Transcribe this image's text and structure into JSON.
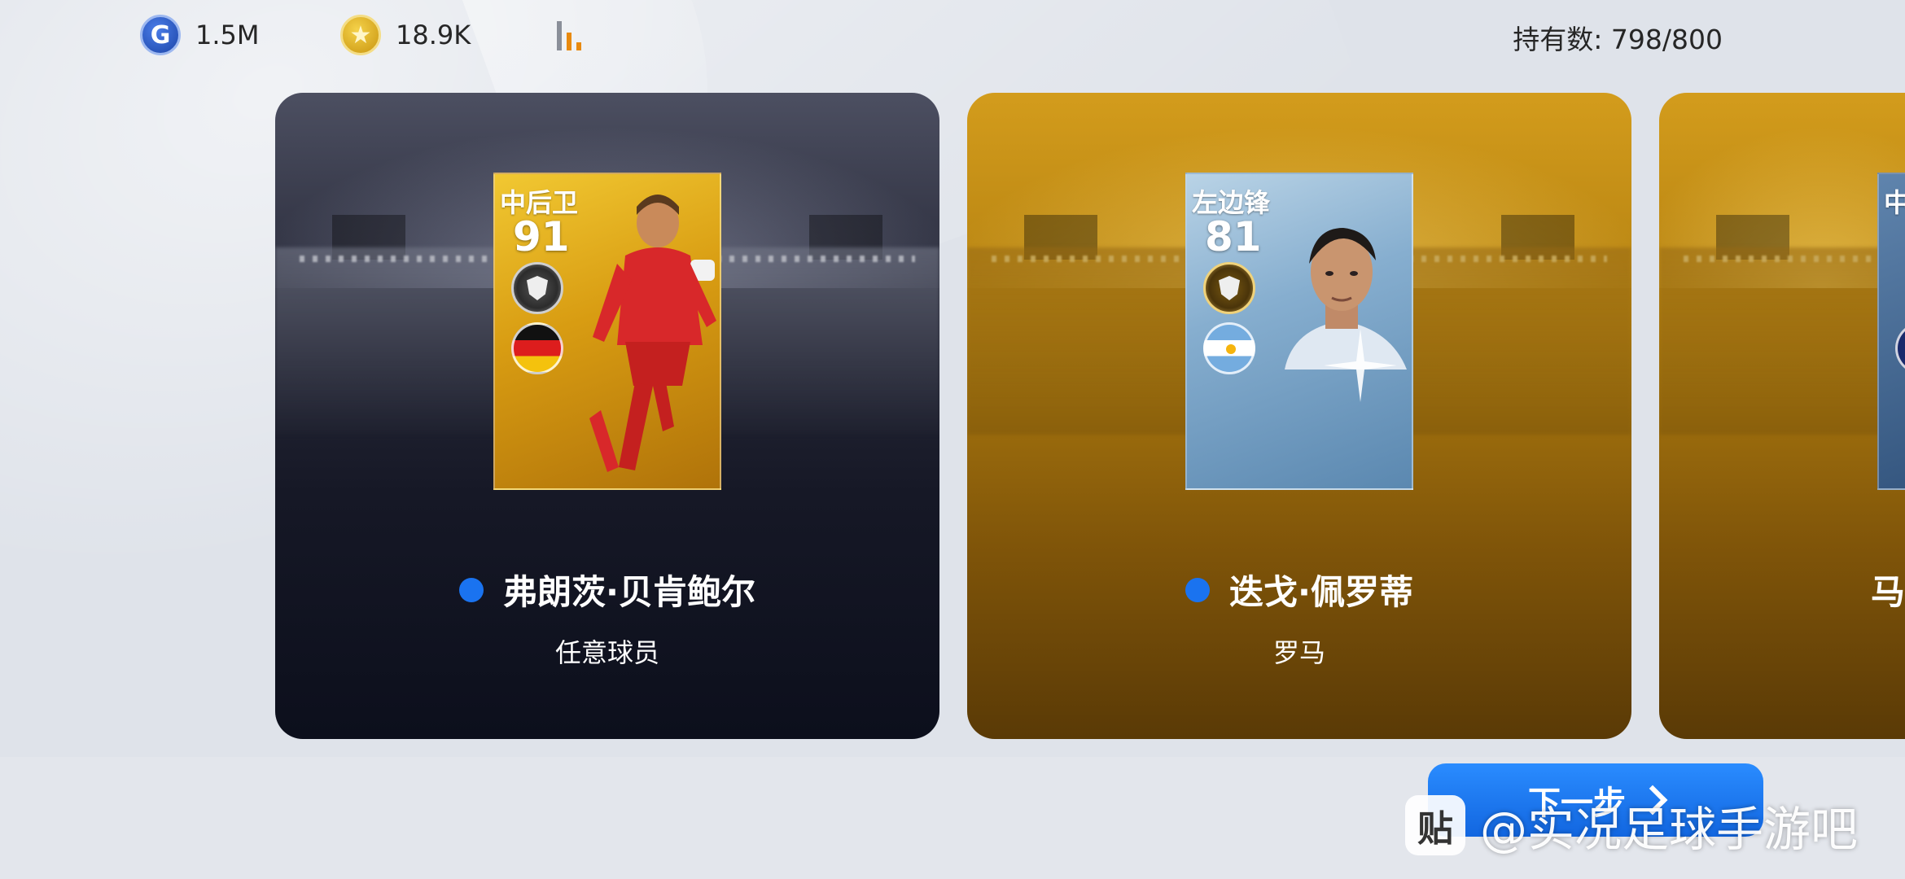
{
  "top_bar": {
    "gp": {
      "icon": "gp-coin-icon",
      "letter": "G",
      "value": "1.5M"
    },
    "coins": {
      "icon": "star-coin-icon",
      "letter": "★",
      "value": "18.9K"
    },
    "holding": "持有数: 798/800"
  },
  "cards": [
    {
      "position": "中后卫",
      "rating": "91",
      "name": "弗朗茨·贝肯鲍尔",
      "subtitle": "任意球员",
      "flag": "germany-flag",
      "theme": "dark"
    },
    {
      "position": "左边锋",
      "rating": "81",
      "name": "迭戈·佩罗蒂",
      "subtitle": "罗马",
      "flag": "argentina-flag",
      "theme": "gold"
    },
    {
      "position": "中",
      "name_partial": "马",
      "theme": "gold"
    }
  ],
  "next_button": {
    "label": "下一步"
  },
  "watermark": {
    "logo": "贴",
    "text": "@实况足球手游吧"
  },
  "colors": {
    "accent_blue": "#1a73f0",
    "gold": "#d39c1c",
    "dark_card": "#161826"
  }
}
